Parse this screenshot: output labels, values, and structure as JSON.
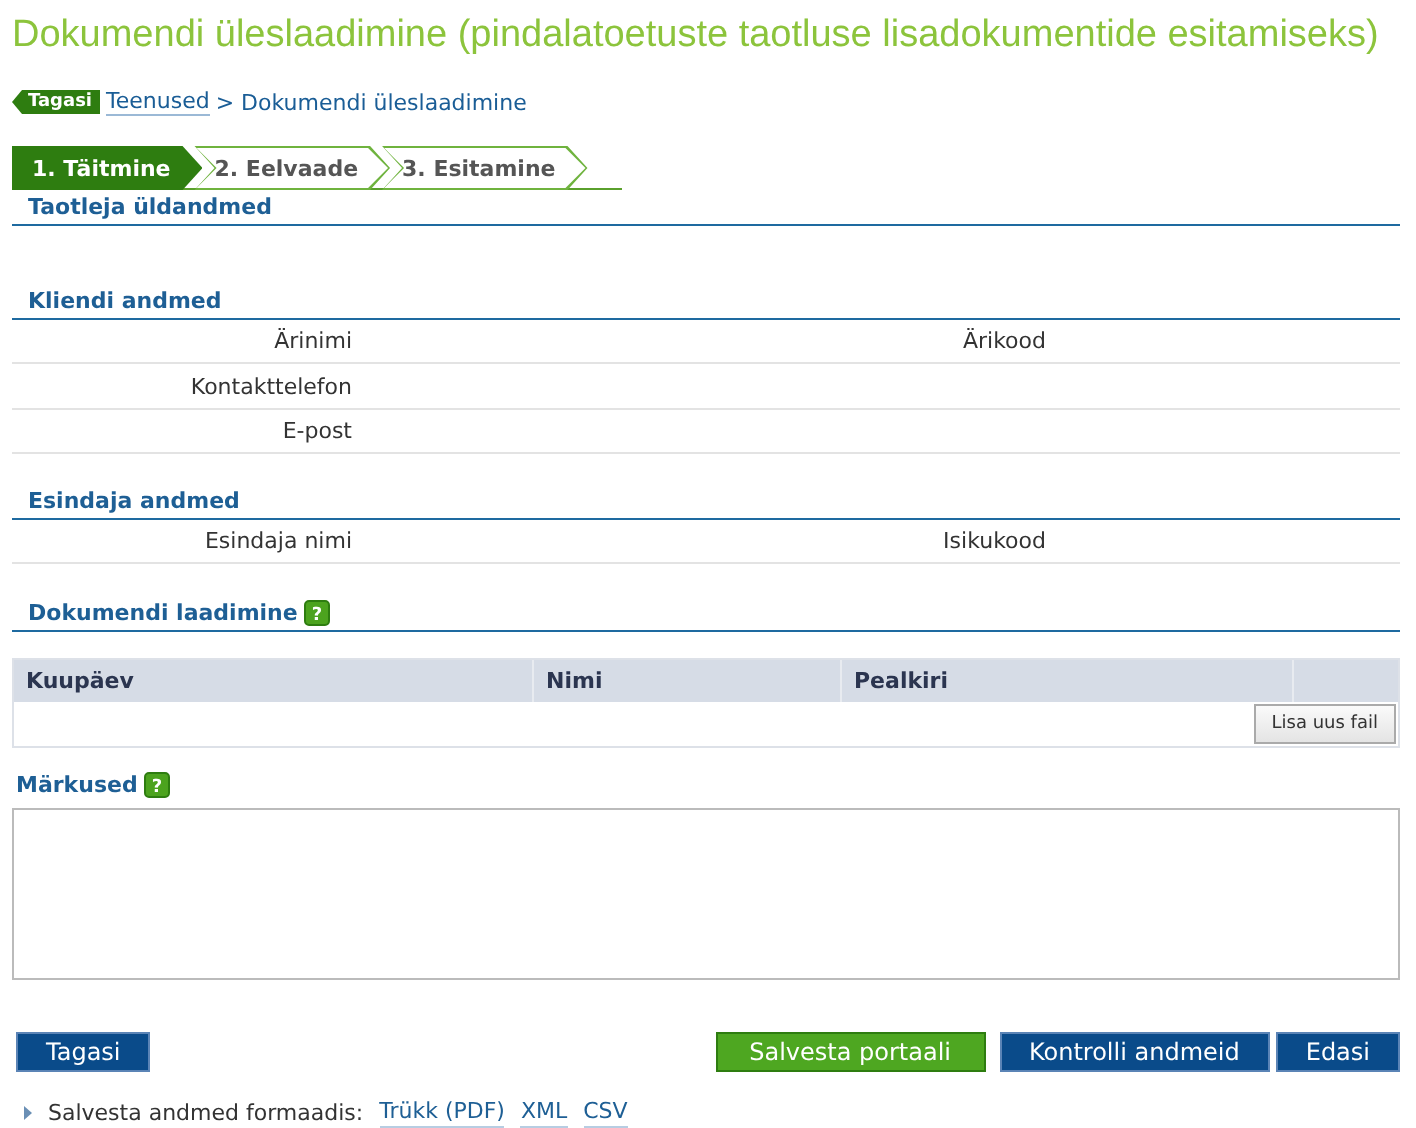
{
  "title": "Dokumendi üleslaadimine (pindalatoetuste taotluse lisadokumentide esitamiseks)",
  "breadcrumb": {
    "back": "Tagasi",
    "link": "Teenused",
    "separator": ">",
    "current": "Dokumendi üleslaadimine"
  },
  "steps": [
    {
      "label": "1. Täitmine",
      "selected": true
    },
    {
      "label": "2. Eelvaade",
      "selected": false
    },
    {
      "label": "3. Esitamine",
      "selected": false
    }
  ],
  "applicant_section": "Taotleja üldandmed",
  "client": {
    "heading": "Kliendi andmed",
    "rows": [
      {
        "label": "Ärinimi",
        "label_2": "Ärikood"
      },
      {
        "label": "Kontakttelefon"
      },
      {
        "label": "E-post"
      }
    ]
  },
  "representative": {
    "heading": "Esindaja andmed",
    "rows": [
      {
        "label": "Esindaja nimi",
        "label_2": "Isikukood"
      }
    ]
  },
  "documents": {
    "heading": "Dokumendi laadimine",
    "help_icon": "?",
    "columns": [
      "Kuupäev",
      "Nimi",
      "Pealkiri"
    ],
    "add_button": "Lisa uus fail"
  },
  "notes": {
    "heading": "Märkused",
    "help_icon": "?"
  },
  "buttons": {
    "back": "Tagasi",
    "save": "Salvesta portaali",
    "check": "Kontrolli andmeid",
    "next": "Edasi"
  },
  "export": {
    "label": "Salvesta andmed formaadis:",
    "links": [
      "Trükk (PDF)",
      "XML",
      "CSV"
    ]
  }
}
